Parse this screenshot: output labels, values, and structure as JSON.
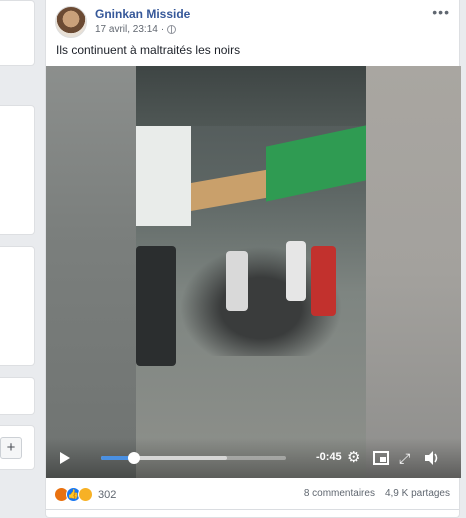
{
  "post": {
    "author": "Gninkan Misside",
    "timestamp": "17 avril, 23:14",
    "audience_icon": "globe-icon",
    "caption": "Ils continuent à maltraités les noirs"
  },
  "video": {
    "time_remaining": "-0:45",
    "progress_fraction": 0.18,
    "buffered_fraction": 0.68
  },
  "footer": {
    "reaction_icons": [
      "angry-icon",
      "like-icon",
      "sad-icon"
    ],
    "reaction_count": "302",
    "comments": "8 commentaires",
    "shares": "4,9 K partages"
  },
  "left_panel": {
    "add_label": "+"
  },
  "colors": {
    "link_blue": "#365899",
    "progress_blue": "#4a90e2",
    "page_bg": "#e9ebee"
  }
}
